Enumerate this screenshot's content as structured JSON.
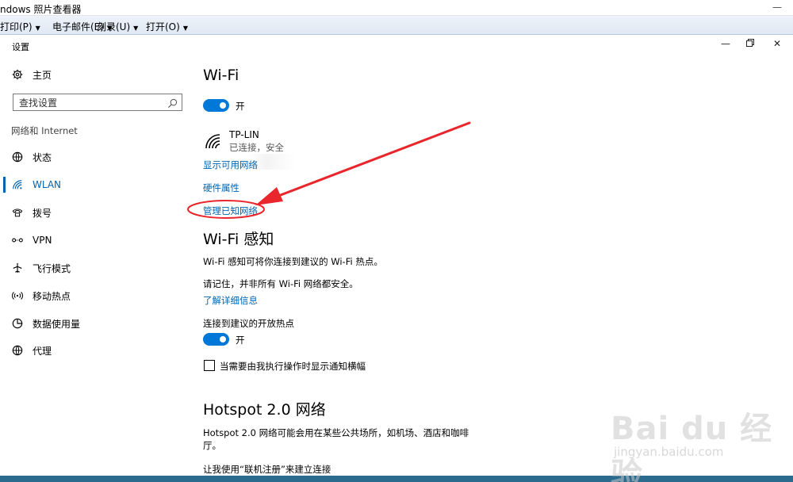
{
  "viewer": {
    "title": "ndows 照片查看器",
    "menu": [
      "打印(P)",
      "电子邮件(E)",
      "刻录(U)",
      "打开(O)"
    ]
  },
  "settings": {
    "title": "设置",
    "sidebar": {
      "home": "主页",
      "search_placeholder": "查找设置",
      "section": "网络和 Internet",
      "items": [
        "状态",
        "WLAN",
        "拨号",
        "VPN",
        "飞行模式",
        "移动热点",
        "数据使用量",
        "代理"
      ]
    },
    "wifi": {
      "heading": "Wi-Fi",
      "toggle_label": "开",
      "network_name": "TP-LIN",
      "network_status": "已连接，安全",
      "show_available": "显示可用网络",
      "hardware_props": "硬件属性",
      "manage_known": "管理已知网络"
    },
    "sense": {
      "heading": "Wi-Fi 感知",
      "desc": "Wi-Fi 感知可将你连接到建议的 Wi-Fi 热点。",
      "note": "请记住，并非所有 Wi-Fi 网络都安全。",
      "learn_more": "了解详细信息",
      "connect_label": "连接到建议的开放热点",
      "toggle_label": "开",
      "notify_label": "当需要由我执行操作时显示通知横幅"
    },
    "hotspot": {
      "heading": "Hotspot 2.0 网络",
      "desc_line1": "Hotspot 2.0 网络可能会用在某些公共场所，如机场、酒店和咖啡",
      "desc_line2": "厅。",
      "online_signup": "让我使用“联机注册”来建立连接"
    }
  },
  "watermark": {
    "main": "Bai du 经验",
    "sub": "jingyan.baidu.com"
  },
  "colors": {
    "accent": "#0078d7",
    "link": "#0063b1",
    "annotation": "#e8262b"
  }
}
